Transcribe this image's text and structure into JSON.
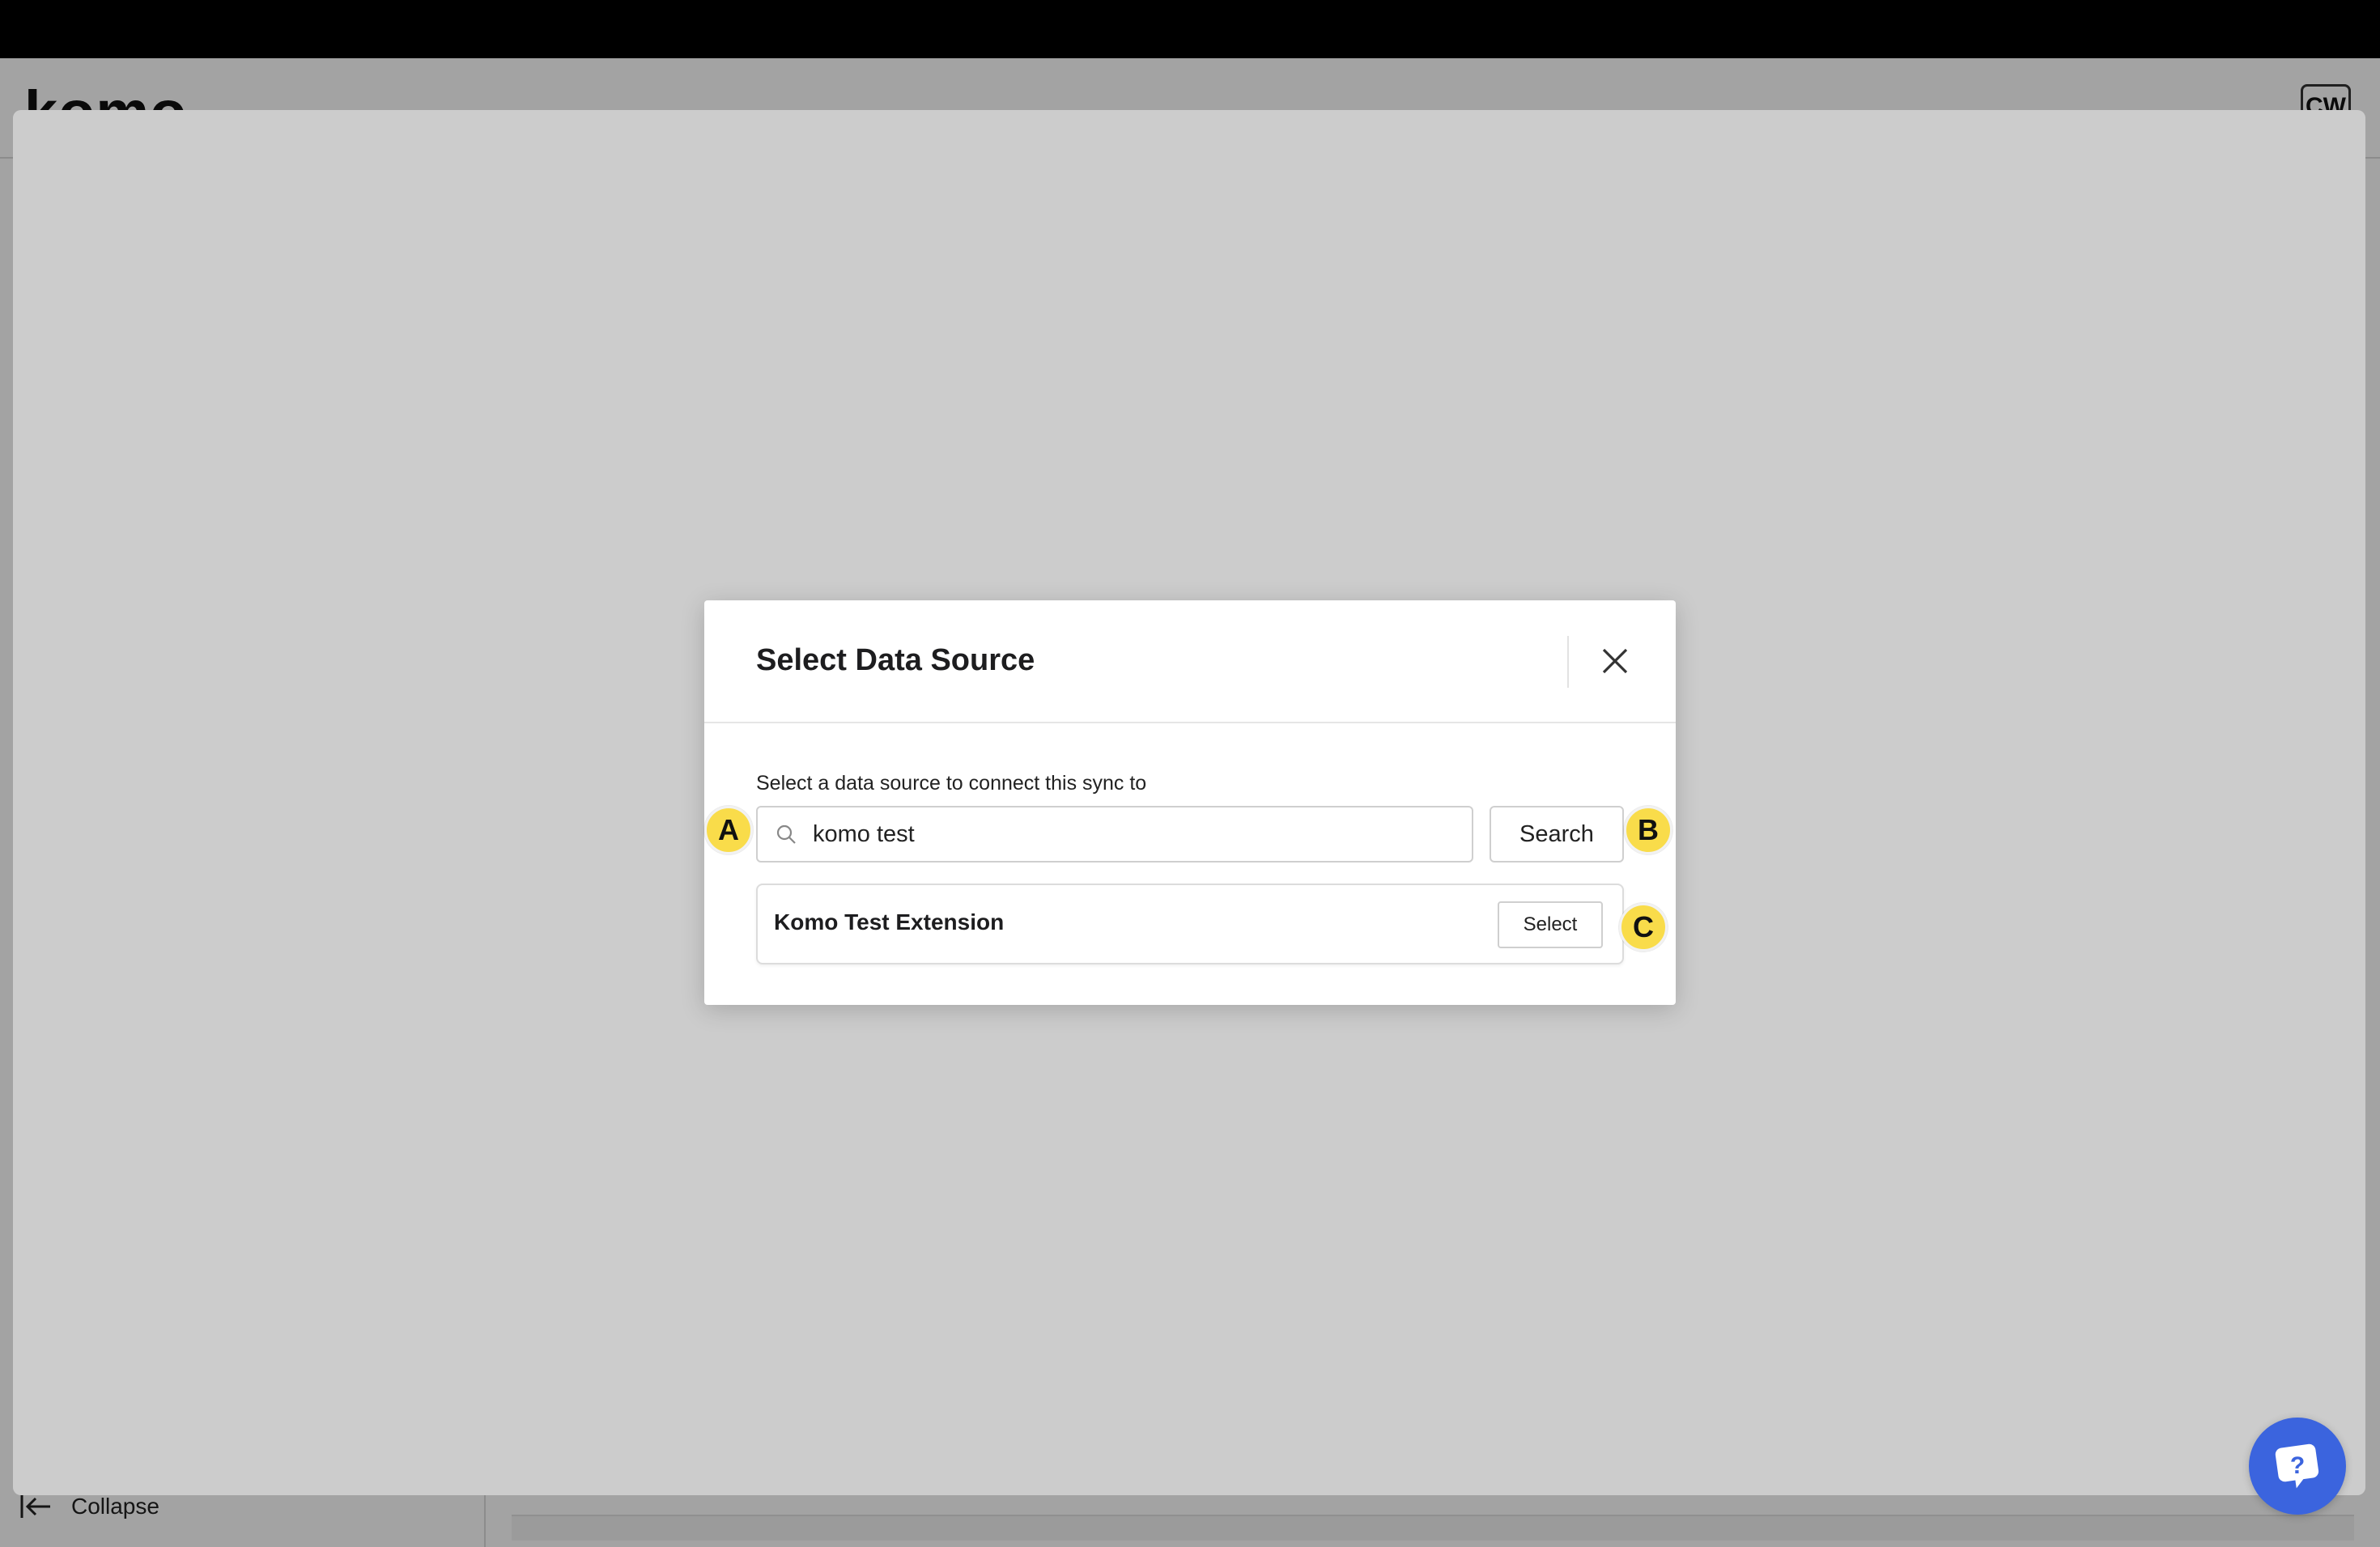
{
  "app": {
    "logo_text": "komo",
    "user_initials": "CW",
    "sidebar": {
      "collapse_label": "Collapse"
    }
  },
  "modal": {
    "title": "Select Data Source",
    "label": "Select a data source to connect this sync to",
    "search": {
      "value": "komo test",
      "button_label": "Search"
    },
    "results": [
      {
        "name": "Komo Test Extension",
        "action_label": "Select"
      }
    ]
  },
  "annotations": {
    "a": "A",
    "b": "B",
    "c": "C"
  },
  "colors": {
    "marker": "#f9dc4a",
    "help_button": "#3b64de"
  },
  "icons": {
    "close": "close-icon",
    "search": "search-icon",
    "collapse": "collapse-left-icon",
    "help": "help-chat-icon"
  }
}
